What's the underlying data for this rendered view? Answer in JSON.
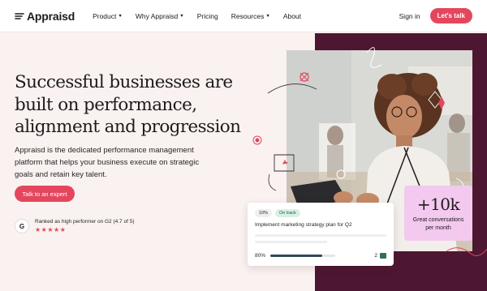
{
  "nav": {
    "logo": "Appraisd",
    "links": [
      {
        "label": "Product",
        "has_caret": true
      },
      {
        "label": "Why Appraisd",
        "has_caret": true
      },
      {
        "label": "Pricing",
        "has_caret": false
      },
      {
        "label": "Resources",
        "has_caret": true
      },
      {
        "label": "About",
        "has_caret": false
      }
    ],
    "signin": "Sign in",
    "cta": "Let's talk"
  },
  "hero": {
    "headline": "Successful businesses are built on performance, alignment and progression",
    "subcopy": "Appraisd is the dedicated performance management platform that helps your business execute on strategic goals and retain key talent.",
    "cta": "Talk to an expert",
    "g2_logo": "G",
    "g2_text": "Ranked as high performer on G2 (4.7 of 5)",
    "stars": "★★★★★",
    "rating": 4.7
  },
  "stat_card": {
    "number": "+10k",
    "label": "Great conversations per month"
  },
  "task_card": {
    "progress_badge": "10%",
    "status_badge": "On track",
    "title": "Implement marketing strategy plan for Q2",
    "progress_label": "80%",
    "progress_value": 0.8,
    "comment_count": "2"
  },
  "colors": {
    "accent": "#e4475d",
    "hero_dark": "#4d1732",
    "stat_card_bg": "#f3c9ef",
    "hero_light_bg": "#f9f2f0"
  }
}
